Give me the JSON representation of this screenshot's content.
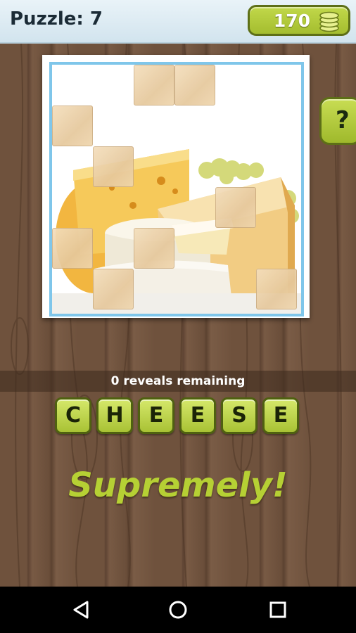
{
  "header": {
    "puzzle_label": "Puzzle: 7",
    "coins": "170",
    "coin_icon": "coin-stack-icon"
  },
  "hint_button": {
    "label": "?"
  },
  "picture": {
    "subject": "cheese",
    "colors": {
      "frame_border": "#7fc6ea",
      "tile": "#ecd3a8"
    }
  },
  "reveals": {
    "text": "0 reveals remaining"
  },
  "answer": {
    "letters": [
      "C",
      "H",
      "E",
      "E",
      "S",
      "E"
    ]
  },
  "feedback": {
    "text": "Supremely!"
  },
  "navbar": {
    "back_icon": "back-triangle-icon",
    "home_icon": "home-circle-icon",
    "recents_icon": "recents-square-icon"
  },
  "colors": {
    "accent_green": "#b6d034",
    "wood_brown": "#6f523d",
    "header_bg": "#e2eff6"
  }
}
